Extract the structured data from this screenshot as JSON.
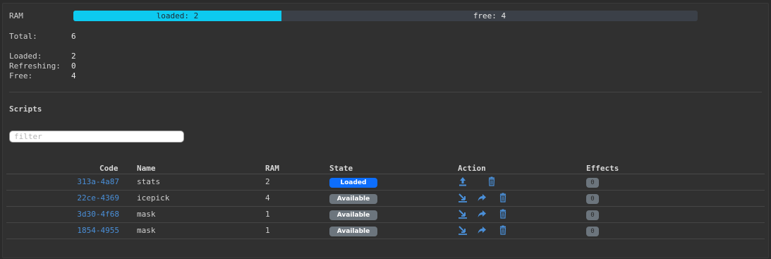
{
  "ram": {
    "label": "RAM",
    "loaded_text": "loaded: 2",
    "free_text": "free: 4",
    "loaded_fraction": 0.3333,
    "total_label": "Total:",
    "total_value": "6",
    "loaded_label": "Loaded:",
    "loaded_value": "2",
    "refreshing_label": "Refreshing:",
    "refreshing_value": "0",
    "free_label": "Free:",
    "free_value": "4"
  },
  "scripts": {
    "title": "Scripts",
    "filter_placeholder": "filter",
    "columns": {
      "code": "Code",
      "name": "Name",
      "ram": "RAM",
      "state": "State",
      "action": "Action",
      "effects": "Effects"
    },
    "rows": [
      {
        "code": "313a-4a87",
        "name": "stats",
        "ram": "2",
        "state": "Loaded",
        "effects": "0"
      },
      {
        "code": "22ce-4369",
        "name": "icepick",
        "ram": "4",
        "state": "Available",
        "effects": "0"
      },
      {
        "code": "3d30-4f68",
        "name": "mask",
        "ram": "1",
        "state": "Available",
        "effects": "0"
      },
      {
        "code": "1854-4955",
        "name": "mask",
        "ram": "1",
        "state": "Available",
        "effects": "0"
      }
    ]
  },
  "colors": {
    "accent": "#0dcaf0",
    "link": "#4a8fd8",
    "badge_loaded": "#0d6efd",
    "badge_available": "#6c757d"
  }
}
